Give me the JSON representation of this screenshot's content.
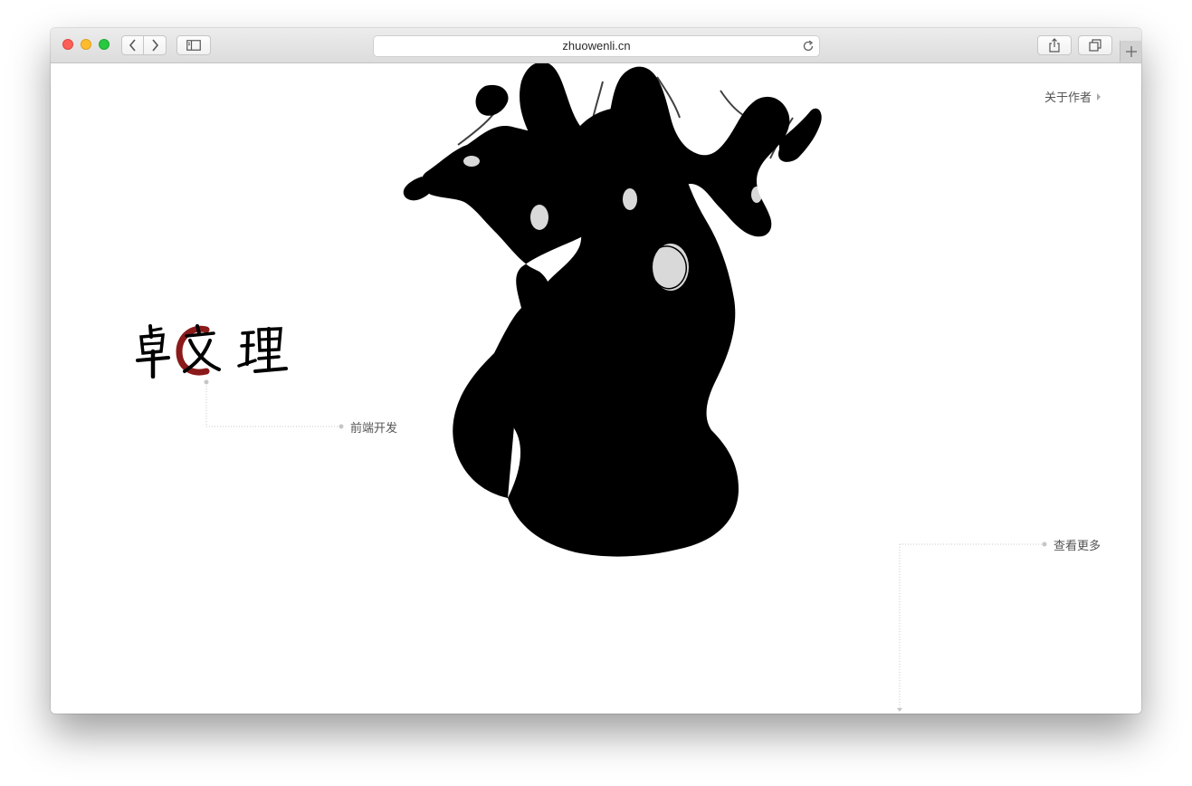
{
  "browser": {
    "url": "zhuowenli.cn",
    "icons": [
      "back-icon",
      "forward-icon",
      "sidebar-icon",
      "reload-icon",
      "share-icon",
      "tabs-overview-icon",
      "plus-icon"
    ]
  },
  "page": {
    "logo_text": "卓文理",
    "nav": {
      "about_label": "关于作者"
    },
    "tagline": "前端开发",
    "more_label": "查看更多"
  },
  "colors": {
    "logo_accent": "#8b1a1a",
    "ink": "#000000",
    "text": "#555555"
  }
}
